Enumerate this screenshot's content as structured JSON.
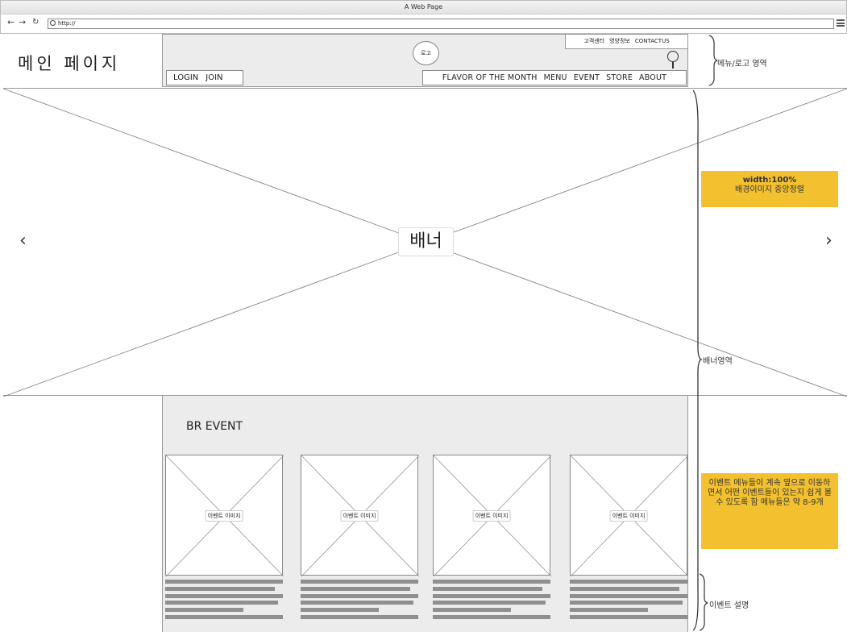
{
  "window": {
    "title": "A Web Page",
    "url": "http://",
    "back_icon": "back-arrow-icon",
    "forward_icon": "forward-arrow-icon",
    "reload_icon": "reload-icon"
  },
  "header": {
    "site_title": "메인 페이지",
    "logo": "로고",
    "auth": {
      "login": "LOGIN",
      "join": "JOIN"
    },
    "util_links": [
      "고객센터",
      "영양정보",
      "CONTACTUS"
    ],
    "gnb": [
      "FLAVOR OF THE MONTH",
      "MENU",
      "EVENT",
      "STORE",
      "ABOUT"
    ]
  },
  "banner": {
    "label": "배너",
    "prev": "‹",
    "next": "›"
  },
  "events": {
    "heading": "BR EVENT",
    "cards": [
      {
        "image_label": "이벤트 이미지"
      },
      {
        "image_label": "이벤트 이미지"
      },
      {
        "image_label": "이벤트 이미지"
      },
      {
        "image_label": "이벤트 이미지"
      }
    ]
  },
  "annotations": {
    "menu_logo_area": "메뉴/로고 영역",
    "banner_area": "배너영역",
    "event_desc": "이벤트 설명",
    "sticky_banner_line1": "width:100%",
    "sticky_banner_line2": "배경이미지 중앙정렬",
    "sticky_event": "이벤트 메뉴들이 계속 옆으로 이동하면서 어떤 이벤트들이 있는지 쉽게 볼 수 있도록 함 메뉴들은 약 8-9개",
    "sticky_color": "#f3c130"
  }
}
